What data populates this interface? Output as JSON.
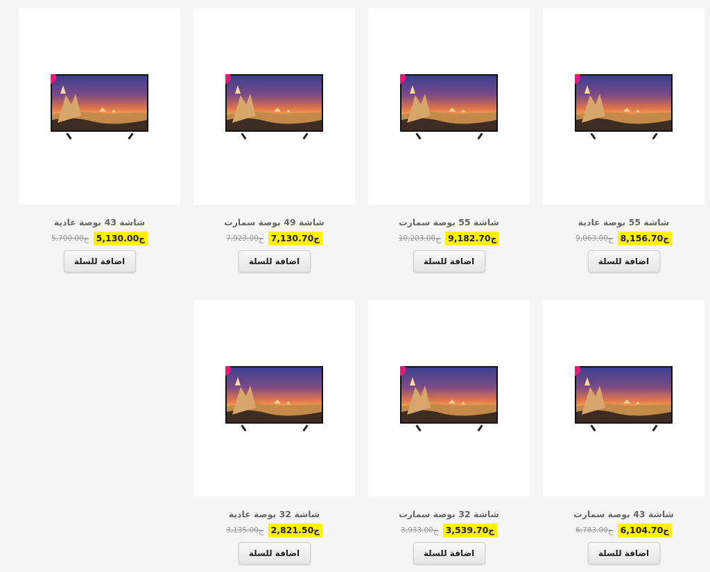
{
  "currency_symbol": "ج",
  "products": [
    {
      "title": "شاشة 43 بوصة عادية",
      "price": "5,130.00",
      "old_price": "5,700.00",
      "button": "اضافة للسلة"
    },
    {
      "title": "شاشة 49 بوصة سمارت",
      "price": "7,130.70",
      "old_price": "7,923.00",
      "button": "اضافة للسلة"
    },
    {
      "title": "شاشة 55 بوصة سمارت",
      "price": "9,182.70",
      "old_price": "10,203.00",
      "button": "اضافة للسلة"
    },
    {
      "title": "شاشة 55 بوصة عادية",
      "price": "8,156.70",
      "old_price": "9,063.00",
      "button": "اضافة للسلة"
    },
    {
      "title": "شاشة 32 بوصة عادية",
      "price": "2,821.50",
      "old_price": "3,135.00",
      "button": "اضافة للسلة"
    },
    {
      "title": "شاشة 32 بوصة سمارت",
      "price": "3,539.70",
      "old_price": "3,933.00",
      "button": "اضافة للسلة"
    },
    {
      "title": "شاشة 43 بوصة سمارت",
      "price": "6,104.70",
      "old_price": "6,783.00",
      "button": "اضافة للسلة"
    }
  ],
  "colors": {
    "page_bg": "#f5f5f5",
    "card_bg": "#ffffff",
    "price_highlight": "#fff200",
    "old_price": "#999999",
    "title": "#666666"
  },
  "icons": {
    "product_image": "tv-icon"
  }
}
